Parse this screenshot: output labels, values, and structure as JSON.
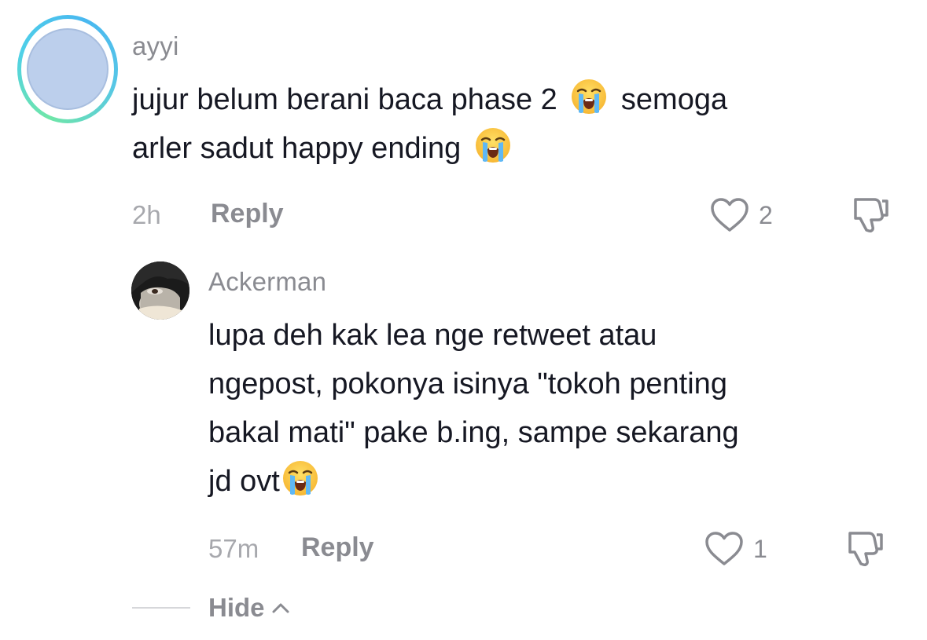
{
  "comment": {
    "username": "ayyi",
    "text_line1_a": "jujur belum berani baca phase 2",
    "text_line1_b": "semoga",
    "text_line2": "arler sadut happy ending",
    "emoji": "loudly-crying-face",
    "time": "2h",
    "reply_label": "Reply",
    "like_count": "2"
  },
  "reply": {
    "username": "Ackerman",
    "text_line1": "lupa deh kak lea nge retweet atau",
    "text_line2": "ngepost, pokonya isinya \"tokoh penting",
    "text_line3": "bakal mati\" pake b.ing, sampe sekarang",
    "text_line4": "jd ovt",
    "emoji": "loudly-crying-face",
    "time": "57m",
    "reply_label": "Reply",
    "like_count": "1"
  },
  "thread": {
    "hide_label": "Hide"
  },
  "colors": {
    "text_primary": "#161823",
    "text_secondary": "#8a8b91",
    "avatar_fill": "#bccfec",
    "ring_gradient": [
      "#6fe6a8",
      "#4fd0e8",
      "#49b8f0"
    ]
  }
}
